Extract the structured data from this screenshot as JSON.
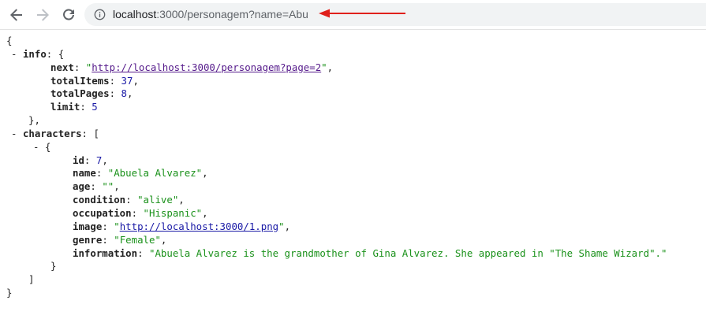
{
  "browser": {
    "url_host": "localhost",
    "url_path": ":3000/personagem?name=Abu",
    "annotation_color": "#e0201b"
  },
  "json_view": {
    "open_brace": "{",
    "close_brace": "}",
    "toggle": "-",
    "info": {
      "key": "info",
      "open": ": {",
      "close": "},",
      "next_key": "next",
      "next_value": "http://localhost:3000/personagem?page=2",
      "totalItems_key": "totalItems",
      "totalItems_value": "37",
      "totalPages_key": "totalPages",
      "totalPages_value": "8",
      "limit_key": "limit",
      "limit_value": "5"
    },
    "characters": {
      "key": "characters",
      "open": ": [",
      "close": "]",
      "item_open": "{",
      "item_close": "}",
      "fields": {
        "id_key": "id",
        "id_value": "7",
        "name_key": "name",
        "name_value": "\"Abuela Alvarez\"",
        "age_key": "age",
        "age_value": "\"\"",
        "condition_key": "condition",
        "condition_value": "\"alive\"",
        "occupation_key": "occupation",
        "occupation_value": "\"Hispanic\"",
        "image_key": "image",
        "image_value": "http://localhost:3000/1.png",
        "genre_key": "genre",
        "genre_value": "\"Female\"",
        "information_key": "information",
        "information_value": "\"Abuela Alvarez is the grandmother of Gina Alvarez. She appeared in \"The Shame Wizard\".\""
      }
    }
  }
}
